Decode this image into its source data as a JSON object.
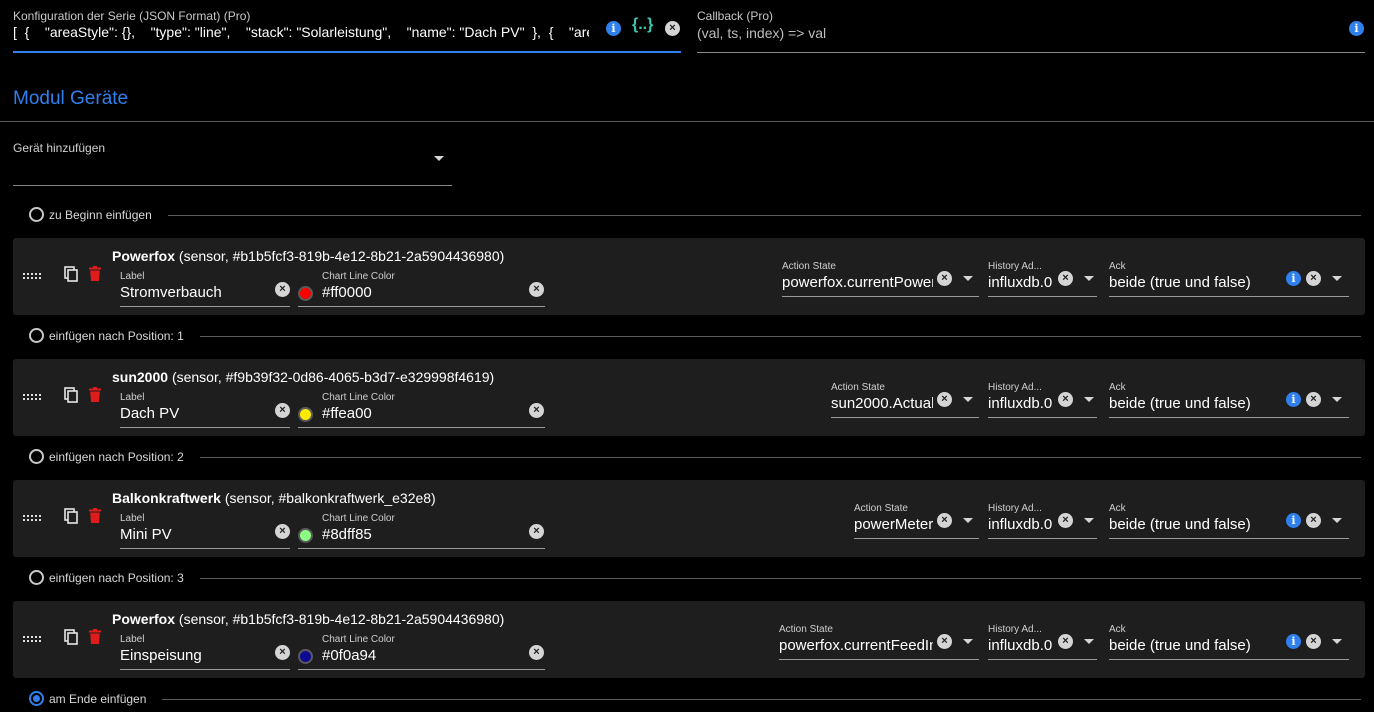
{
  "config": {
    "label": "Konfiguration der Serie (JSON Format) (Pro)",
    "value": "[  {    \"areaStyle\": {},    \"type\": \"line\",    \"stack\": \"Solarleistung\",    \"name\": \"Dach PV\"  },  {    \"areaS",
    "braces_label": "{..}"
  },
  "callback": {
    "label": "Callback (Pro)",
    "value": "(val, ts, index) => val"
  },
  "section_title": "Modul Geräte",
  "add_device": {
    "label": "Gerät hinzufügen",
    "value": ""
  },
  "positions": [
    {
      "label": "zu Beginn einfügen",
      "selected": false
    },
    {
      "label": "einfügen nach Position: 1",
      "selected": false
    },
    {
      "label": "einfügen nach Position: 2",
      "selected": false
    },
    {
      "label": "einfügen nach Position: 3",
      "selected": false
    },
    {
      "label": "am Ende einfügen",
      "selected": true
    }
  ],
  "field_captions": {
    "label": "Label",
    "color": "Chart Line Color",
    "action_state": "Action State",
    "history": "History Ad...",
    "ack": "Ack"
  },
  "devices": [
    {
      "name": "Powerfox",
      "info": "(sensor, #b1b5fcf3-819b-4e12-8b21-2a5904436980)",
      "label": "Stromverbauch",
      "color": "#ff0000",
      "action_state": "powerfox.currentPower",
      "history": "influxdb.0",
      "ack": "beide (true und false)"
    },
    {
      "name": "sun2000",
      "info": "(sensor, #f9b39f32-0d86-4065-b3d7-e329998f4619)",
      "label": "Dach PV",
      "color": "#ffea00",
      "action_state": "sun2000.Actual",
      "history": "influxdb.0",
      "ack": "beide (true und false)"
    },
    {
      "name": "Balkonkraftwerk",
      "info": "(sensor, #balkonkraftwerk_e32e8)",
      "label": "Mini PV",
      "color": "#8dff85",
      "action_state": "powerMeter",
      "history": "influxdb.0",
      "ack": "beide (true und false)"
    },
    {
      "name": "Powerfox",
      "info": "(sensor, #b1b5fcf3-819b-4e12-8b21-2a5904436980)",
      "label": "Einspeisung",
      "color": "#0f0a94",
      "action_state": "powerfox.currentFeedIn",
      "history": "influxdb.0",
      "ack": "beide (true und false)"
    }
  ]
}
